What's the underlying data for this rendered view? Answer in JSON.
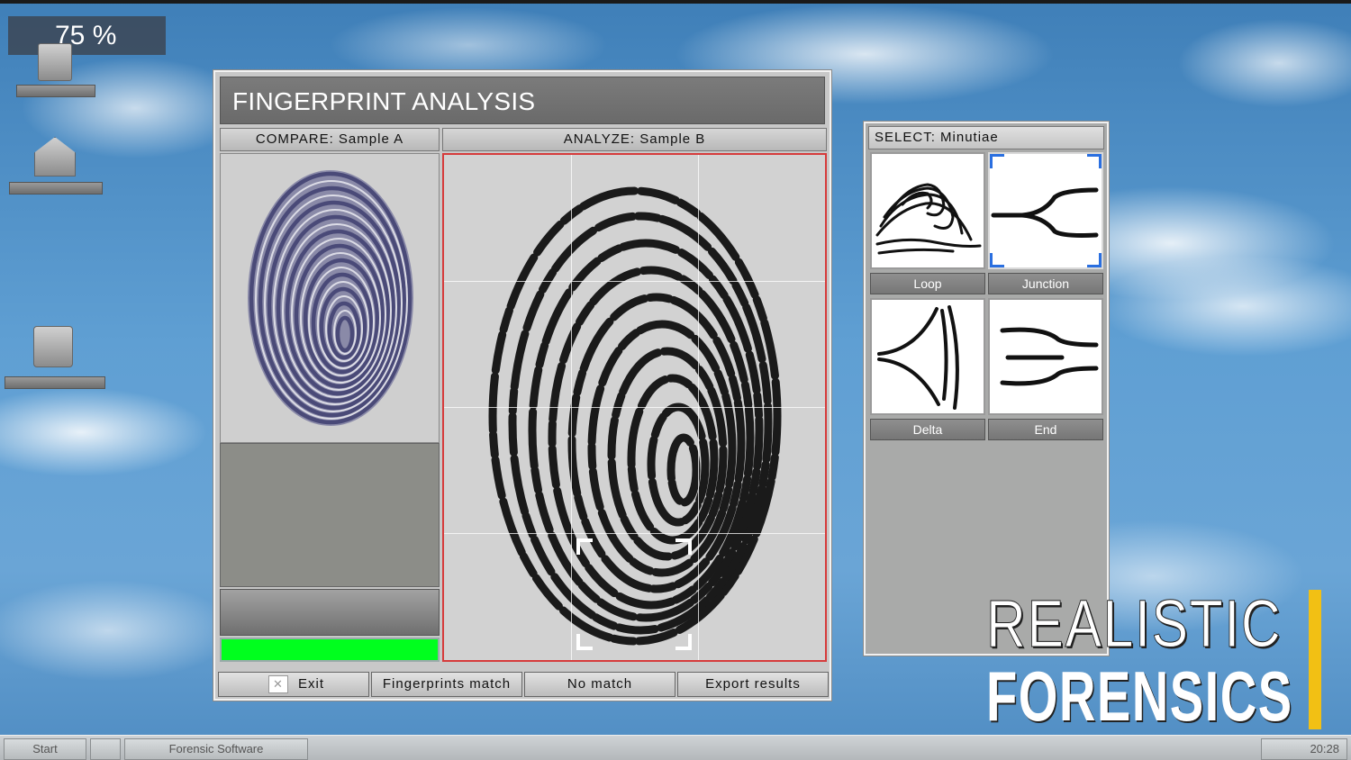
{
  "zoom": {
    "label": "75 %"
  },
  "window": {
    "title": "FINGERPRINT ANALYSIS",
    "compare_header": "COMPARE: Sample A",
    "analyze_header": "ANALYZE: Sample B",
    "buttons": {
      "exit_icon": "✕",
      "exit": "Exit",
      "match": "Fingerprints match",
      "no_match": "No match",
      "export": "Export results"
    },
    "progress_color": "#00ff1e"
  },
  "minutiae": {
    "title": "SELECT: Minutiae",
    "items": [
      {
        "label": "Loop",
        "icon": "loop-minutia-icon",
        "selected": false
      },
      {
        "label": "Junction",
        "icon": "junction-minutia-icon",
        "selected": true
      },
      {
        "label": "Delta",
        "icon": "delta-minutia-icon",
        "selected": false
      },
      {
        "label": "End",
        "icon": "end-minutia-icon",
        "selected": false
      }
    ],
    "selection_color": "#2a6fe0"
  },
  "brand": {
    "line1": "REALISTIC",
    "line2": "FORENSICS",
    "accent": "#f2c014"
  },
  "taskbar": {
    "start": "Start",
    "task": "Forensic Software",
    "clock": "20:28"
  },
  "desktop_icons": [
    "computer-icon",
    "home-icon",
    "network-icon"
  ]
}
